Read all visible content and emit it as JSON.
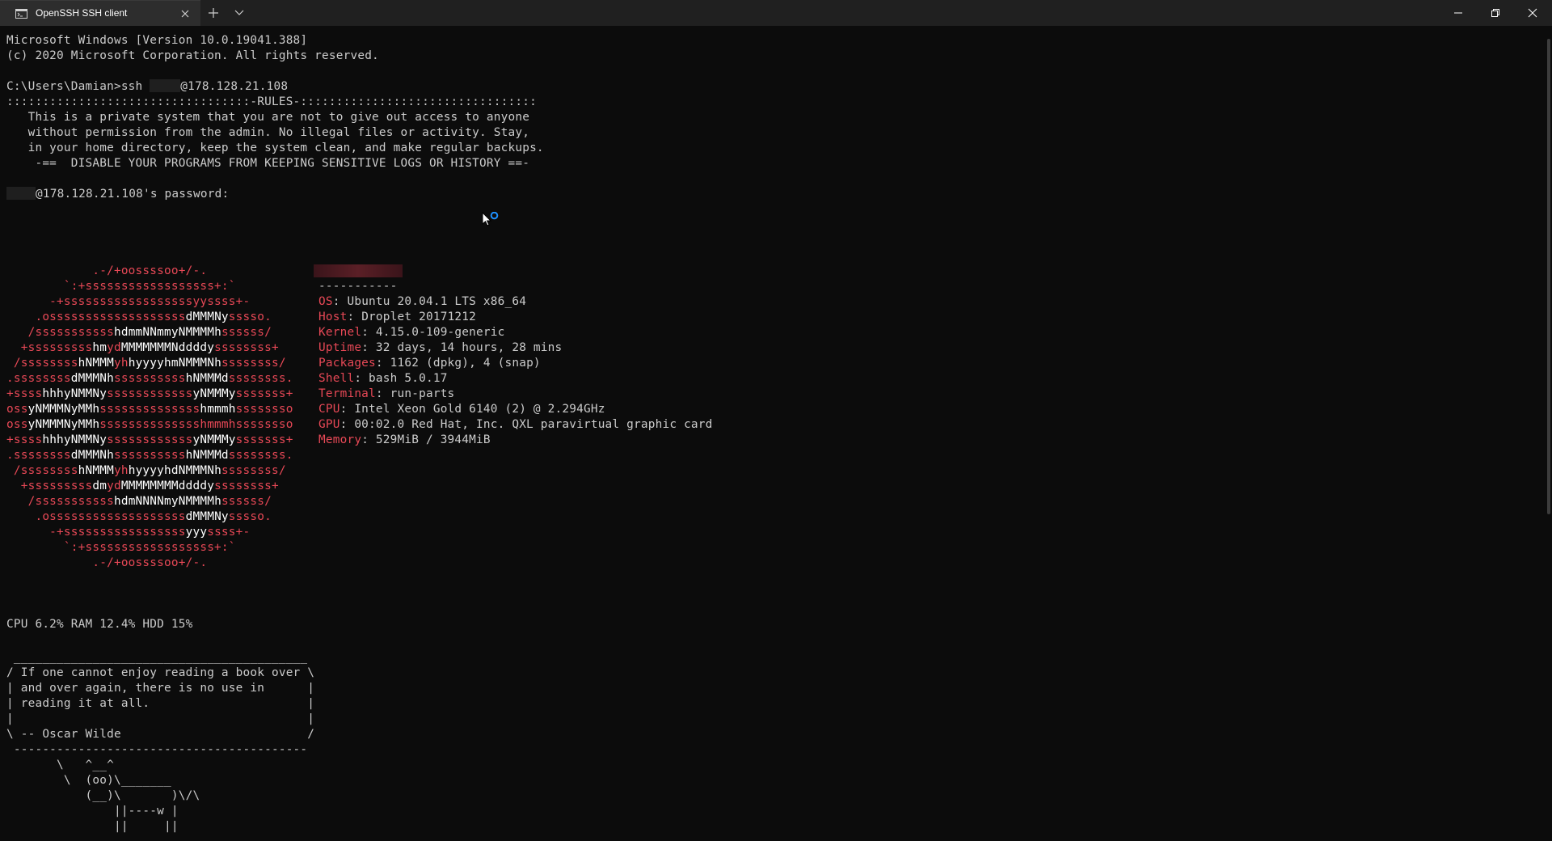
{
  "window": {
    "tab_title": "OpenSSH SSH client",
    "tab_icon": "terminal-icon",
    "new_tab_icon": "plus-icon",
    "dropdown_icon": "chevron-down-icon",
    "controls": [
      "minimize-icon",
      "maximize-icon",
      "close-icon"
    ]
  },
  "terminal": {
    "header_lines": [
      "Microsoft Windows [Version 10.0.19041.388]",
      "(c) 2020 Microsoft Corporation. All rights reserved."
    ],
    "prompt": "C:\\Users\\Damian>ssh ",
    "ssh_host": "@178.128.21.108",
    "rules_lines": [
      "::::::::::::::::::::::::::::::::::-RULES-:::::::::::::::::::::::::::::::::",
      "   This is a private system that you are not to give out access to anyone",
      "   without permission from the admin. No illegal files or activity. Stay,",
      "   in your home directory, keep the system clean, and make regular backups.",
      "    -==  DISABLE YOUR PROGRAMS FROM KEEPING SENSITIVE LOGS OR HISTORY ==-"
    ],
    "password_prompt": "@178.128.21.108's password:",
    "separator": "-----------",
    "sysinfo": [
      {
        "key": "OS",
        "value": ": Ubuntu 20.04.1 LTS x86_64"
      },
      {
        "key": "Host",
        "value": ": Droplet 20171212"
      },
      {
        "key": "Kernel",
        "value": ": 4.15.0-109-generic"
      },
      {
        "key": "Uptime",
        "value": ": 32 days, 14 hours, 28 mins"
      },
      {
        "key": "Packages",
        "value": ": 1162 (dpkg), 4 (snap)"
      },
      {
        "key": "Shell",
        "value": ": bash 5.0.17"
      },
      {
        "key": "Terminal",
        "value": ": run-parts"
      },
      {
        "key": "CPU",
        "value": ": Intel Xeon Gold 6140 (2) @ 2.294GHz"
      },
      {
        "key": "GPU",
        "value": ": 00:02.0 Red Hat, Inc. QXL paravirtual graphic card"
      },
      {
        "key": "Memory",
        "value": ": 529MiB / 3944MiB"
      }
    ],
    "logo_lines": [
      [
        {
          "t": "            .-/+oossssoo+/-.",
          "c": "red"
        }
      ],
      [
        {
          "t": "        `:+ssssssssssssssssss+:`",
          "c": "red"
        }
      ],
      [
        {
          "t": "      -+ssssssssssssssssssyyssss+-",
          "c": "red"
        }
      ],
      [
        {
          "t": "    .osssssssssssssssssss",
          "c": "red"
        },
        {
          "t": "dMMMNy",
          "c": "wht"
        },
        {
          "t": "sssso.",
          "c": "red"
        }
      ],
      [
        {
          "t": "   /sssssssssss",
          "c": "red"
        },
        {
          "t": "hdmmNNmmyNMMMMh",
          "c": "wht"
        },
        {
          "t": "ssssss/",
          "c": "red"
        }
      ],
      [
        {
          "t": "  +sssssssss",
          "c": "red"
        },
        {
          "t": "hm",
          "c": "wht"
        },
        {
          "t": "yd",
          "c": "red"
        },
        {
          "t": "MMMMMMMNddddy",
          "c": "wht"
        },
        {
          "t": "ssssssss+",
          "c": "red"
        }
      ],
      [
        {
          "t": " /ssssssss",
          "c": "red"
        },
        {
          "t": "hNMMM",
          "c": "wht"
        },
        {
          "t": "yh",
          "c": "red"
        },
        {
          "t": "hyyyyhmNMMMNh",
          "c": "wht"
        },
        {
          "t": "ssssssss/",
          "c": "red"
        }
      ],
      [
        {
          "t": ".ssssssss",
          "c": "red"
        },
        {
          "t": "dMMMNh",
          "c": "wht"
        },
        {
          "t": "ssssssssss",
          "c": "red"
        },
        {
          "t": "hNMMMd",
          "c": "wht"
        },
        {
          "t": "ssssssss.",
          "c": "red"
        }
      ],
      [
        {
          "t": "+ssss",
          "c": "red"
        },
        {
          "t": "hhhyNMMNy",
          "c": "wht"
        },
        {
          "t": "ssssssssssss",
          "c": "red"
        },
        {
          "t": "yNMMMy",
          "c": "wht"
        },
        {
          "t": "sssssss+",
          "c": "red"
        }
      ],
      [
        {
          "t": "oss",
          "c": "red"
        },
        {
          "t": "yNMMMNyMMh",
          "c": "wht"
        },
        {
          "t": "ssssssssssssss",
          "c": "red"
        },
        {
          "t": "hmmmh",
          "c": "wht"
        },
        {
          "t": "ssssssso",
          "c": "red"
        }
      ],
      [
        {
          "t": "oss",
          "c": "red"
        },
        {
          "t": "yNMMMNyMMh",
          "c": "wht"
        },
        {
          "t": "sssssssssssssshmmmhssssssso",
          "c": "red"
        }
      ],
      [
        {
          "t": "+ssss",
          "c": "red"
        },
        {
          "t": "hhhyNMMNy",
          "c": "wht"
        },
        {
          "t": "ssssssssssss",
          "c": "red"
        },
        {
          "t": "yNMMMy",
          "c": "wht"
        },
        {
          "t": "sssssss+",
          "c": "red"
        }
      ],
      [
        {
          "t": ".ssssssss",
          "c": "red"
        },
        {
          "t": "dMMMNh",
          "c": "wht"
        },
        {
          "t": "ssssssssss",
          "c": "red"
        },
        {
          "t": "hNMMMd",
          "c": "wht"
        },
        {
          "t": "ssssssss.",
          "c": "red"
        }
      ],
      [
        {
          "t": " /ssssssss",
          "c": "red"
        },
        {
          "t": "hNMMM",
          "c": "wht"
        },
        {
          "t": "yh",
          "c": "red"
        },
        {
          "t": "hyyyyhdNMMMNh",
          "c": "wht"
        },
        {
          "t": "ssssssss/",
          "c": "red"
        }
      ],
      [
        {
          "t": "  +sssssssss",
          "c": "red"
        },
        {
          "t": "dm",
          "c": "wht"
        },
        {
          "t": "yd",
          "c": "red"
        },
        {
          "t": "MMMMMMMMddddy",
          "c": "wht"
        },
        {
          "t": "ssssssss+",
          "c": "red"
        }
      ],
      [
        {
          "t": "   /sssssssssss",
          "c": "red"
        },
        {
          "t": "hdmNNNNmyNMMMMh",
          "c": "wht"
        },
        {
          "t": "ssssss/",
          "c": "red"
        }
      ],
      [
        {
          "t": "    .osssssssssssssssssss",
          "c": "red"
        },
        {
          "t": "dMMMNy",
          "c": "wht"
        },
        {
          "t": "sssso.",
          "c": "red"
        }
      ],
      [
        {
          "t": "      -+sssssssssssssssss",
          "c": "red"
        },
        {
          "t": "yyy",
          "c": "wht"
        },
        {
          "t": "ssss+-",
          "c": "red"
        }
      ],
      [
        {
          "t": "        `:+ssssssssssssssssss+:`",
          "c": "red"
        }
      ],
      [
        {
          "t": "            .-/+oossssoo+/-.",
          "c": "red"
        }
      ]
    ],
    "stats_line": "CPU 6.2% RAM 12.4% HDD 15%",
    "cowsay_lines": [
      " _________________________________________",
      "/ If one cannot enjoy reading a book over \\",
      "| and over again, there is no use in      |",
      "| reading it at all.                      |",
      "|                                         |",
      "\\ -- Oscar Wilde                          /",
      " -----------------------------------------",
      "       \\   ^__^",
      "        \\  (oo)\\_______",
      "           (__)\\       )\\/\\",
      "               ||----w |",
      "               ||     ||"
    ]
  }
}
